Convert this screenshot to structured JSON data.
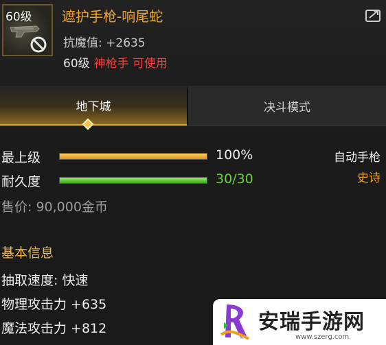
{
  "item": {
    "level_badge": "60级",
    "name": "遮护手枪-响尾蛇",
    "stat": "抗魔值: +2635",
    "req_level": "60级",
    "req_class": "神枪手 可使用"
  },
  "tabs": [
    {
      "label": "地下城",
      "active": true
    },
    {
      "label": "决斗模式",
      "active": false
    }
  ],
  "bars": {
    "grade": {
      "label": "最上级",
      "value": "100%",
      "fill": 1.0,
      "color": "#f0b030"
    },
    "durability": {
      "label": "耐久度",
      "value": "30/30",
      "fill": 1.0,
      "color": "#6cd040"
    }
  },
  "weapon_type": "自动手枪",
  "rarity": "史诗",
  "price": "售价: 90,000金币",
  "basic_info": {
    "title": "基本信息",
    "lines": [
      "抽取速度: 快速",
      "物理攻击力 +635",
      "魔法攻击力 +812"
    ]
  },
  "watermark": {
    "title": "安瑞手游网",
    "url": "www.szerg.com"
  },
  "colors": {
    "accent": "#f0a52a",
    "warning": "#ff3a3a",
    "value_green": "#6cd040"
  }
}
